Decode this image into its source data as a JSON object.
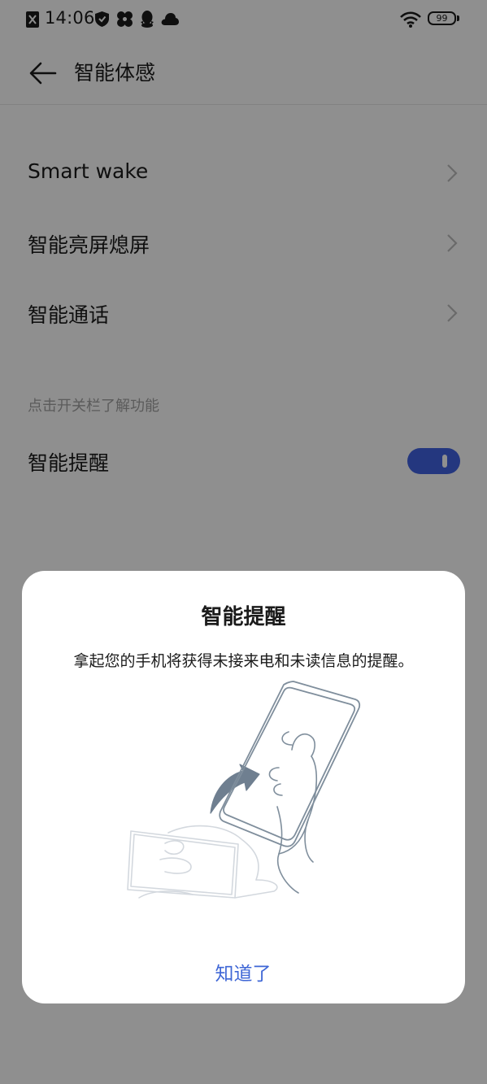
{
  "status_bar": {
    "time": "14:06",
    "battery": "99",
    "icons": [
      "no-sim-icon",
      "shield-icon",
      "fan-icon",
      "qq-icon",
      "cloud-icon",
      "wifi-icon",
      "battery-icon"
    ]
  },
  "header": {
    "back_icon": "arrow-left-icon",
    "title": "智能体感"
  },
  "settings": {
    "items": [
      {
        "label": "Smart wake"
      },
      {
        "label": "智能亮屏熄屏"
      },
      {
        "label": "智能通话"
      }
    ],
    "section_hint": "点击开关栏了解功能",
    "toggle_item": {
      "label": "智能提醒",
      "enabled": true
    }
  },
  "dialog": {
    "title": "智能提醒",
    "message": "拿起您的手机将获得未接来电和未读信息的提醒。",
    "confirm_label": "知道了",
    "illustration": "phone-pickup-illustration"
  },
  "colors": {
    "accent": "#3f67d6",
    "toggle_on": "#4163e3",
    "scrim": "rgba(0,0,0,0.44)"
  }
}
